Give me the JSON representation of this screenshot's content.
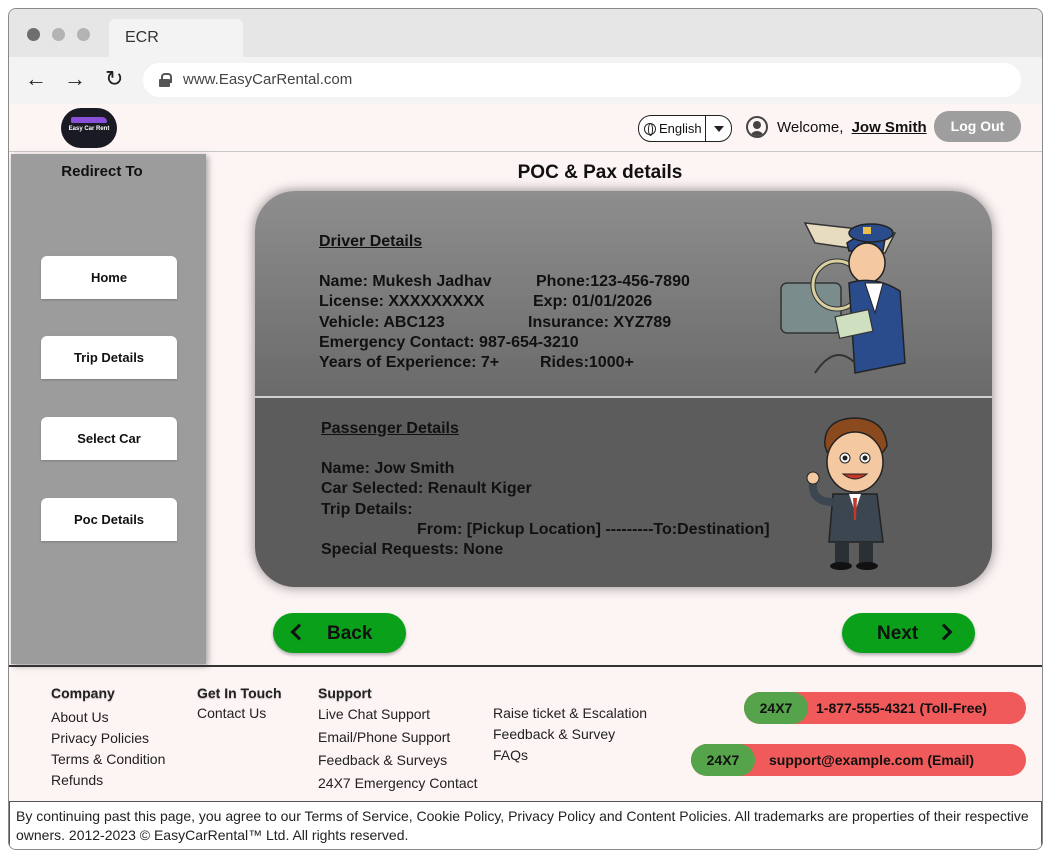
{
  "browser": {
    "tab_title": "ECR",
    "url": "www.EasyCarRental.com"
  },
  "header": {
    "logo_text": "Easy Car Rent",
    "language": "English",
    "welcome_prefix": "Welcome,",
    "user_name": "Jow Smith",
    "logout_label": "Log Out"
  },
  "sidebar": {
    "title": "Redirect To",
    "items": [
      {
        "label": "Home"
      },
      {
        "label": "Trip Details"
      },
      {
        "label": "Select Car"
      },
      {
        "label": "Poc Details"
      }
    ]
  },
  "main": {
    "title": "POC & Pax details",
    "driver": {
      "heading": "Driver Details",
      "name": "Name: Mukesh Jadhav",
      "phone": "Phone:123-456-7890",
      "license": "License: XXXXXXXXX",
      "exp": "Exp: 01/01/2026",
      "vehicle": "Vehicle: ABC123",
      "insurance": "Insurance: XYZ789",
      "emergency": "Emergency Contact: 987-654-3210",
      "experience": "Years of Experience: 7+",
      "rides": "Rides:1000+"
    },
    "passenger": {
      "heading": "Passenger Details",
      "name": "Name: Jow Smith",
      "car": "Car Selected: Renault Kiger",
      "trip_label": "Trip Details:",
      "trip_route": "From: [Pickup Location] ---------To:Destination]",
      "requests": "Special Requests: None"
    },
    "back_label": "Back",
    "next_label": "Next"
  },
  "footer": {
    "company": {
      "heading": "Company",
      "items": [
        "About Us",
        "Privacy Policies",
        "Terms & Condition",
        "Refunds"
      ]
    },
    "contact": {
      "heading": "Get In Touch",
      "items": [
        "Contact Us"
      ]
    },
    "support": {
      "heading": "Support",
      "items": [
        "Live Chat Support",
        "Email/Phone Support",
        "Feedback & Surveys",
        "24X7 Emergency Contact"
      ]
    },
    "support2": {
      "items": [
        "Raise ticket & Escalation",
        "Feedback & Survey",
        "FAQs"
      ]
    },
    "phone_pill": {
      "tag": "24X7",
      "text": "1-877-555-4321 (Toll-Free)"
    },
    "email_pill": {
      "tag": "24X7",
      "text": "support@example.com (Email)"
    },
    "legal": "By continuing past this page, you agree to our Terms of Service, Cookie Policy, Privacy Policy and Content Policies. All trademarks are properties of their respective owners. 2012-2023 © EasyCarRental™ Ltd. All rights reserved."
  },
  "colors": {
    "accent_green": "#0aa01a",
    "pill_red": "#f05a5a",
    "pill_green": "#55a34a",
    "sidebar_gray": "#9c9c9c",
    "page_bg": "#fdf4f4"
  }
}
